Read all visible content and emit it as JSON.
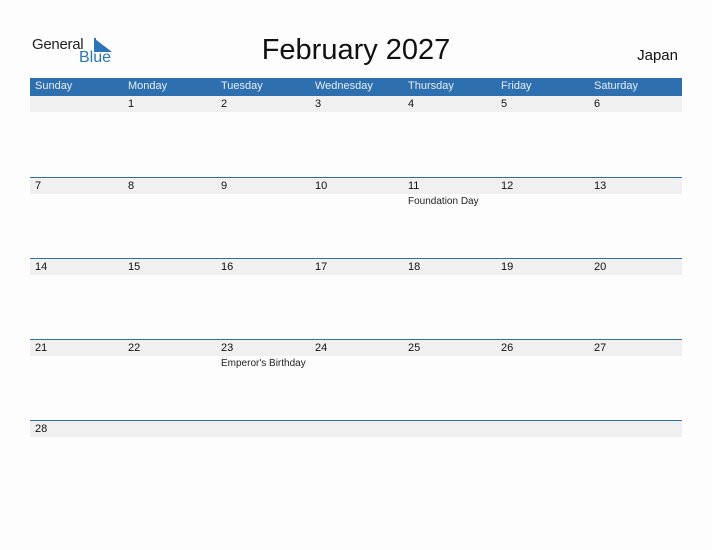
{
  "logo": {
    "general": "General",
    "blue": "Blue"
  },
  "title": "February 2027",
  "country": "Japan",
  "colors": {
    "accent": "#2e6fb0",
    "band": "#f0f0f0"
  },
  "weekdays": [
    "Sunday",
    "Monday",
    "Tuesday",
    "Wednesday",
    "Thursday",
    "Friday",
    "Saturday"
  ],
  "weeks": [
    [
      {
        "day": ""
      },
      {
        "day": "1"
      },
      {
        "day": "2"
      },
      {
        "day": "3"
      },
      {
        "day": "4"
      },
      {
        "day": "5"
      },
      {
        "day": "6"
      }
    ],
    [
      {
        "day": "7"
      },
      {
        "day": "8"
      },
      {
        "day": "9"
      },
      {
        "day": "10"
      },
      {
        "day": "11",
        "holiday": "Foundation Day"
      },
      {
        "day": "12"
      },
      {
        "day": "13"
      }
    ],
    [
      {
        "day": "14"
      },
      {
        "day": "15"
      },
      {
        "day": "16"
      },
      {
        "day": "17"
      },
      {
        "day": "18"
      },
      {
        "day": "19"
      },
      {
        "day": "20"
      }
    ],
    [
      {
        "day": "21"
      },
      {
        "day": "22"
      },
      {
        "day": "23",
        "holiday": "Emperor's Birthday"
      },
      {
        "day": "24"
      },
      {
        "day": "25"
      },
      {
        "day": "26"
      },
      {
        "day": "27"
      }
    ],
    [
      {
        "day": "28"
      },
      {
        "day": ""
      },
      {
        "day": ""
      },
      {
        "day": ""
      },
      {
        "day": ""
      },
      {
        "day": ""
      },
      {
        "day": ""
      }
    ]
  ]
}
